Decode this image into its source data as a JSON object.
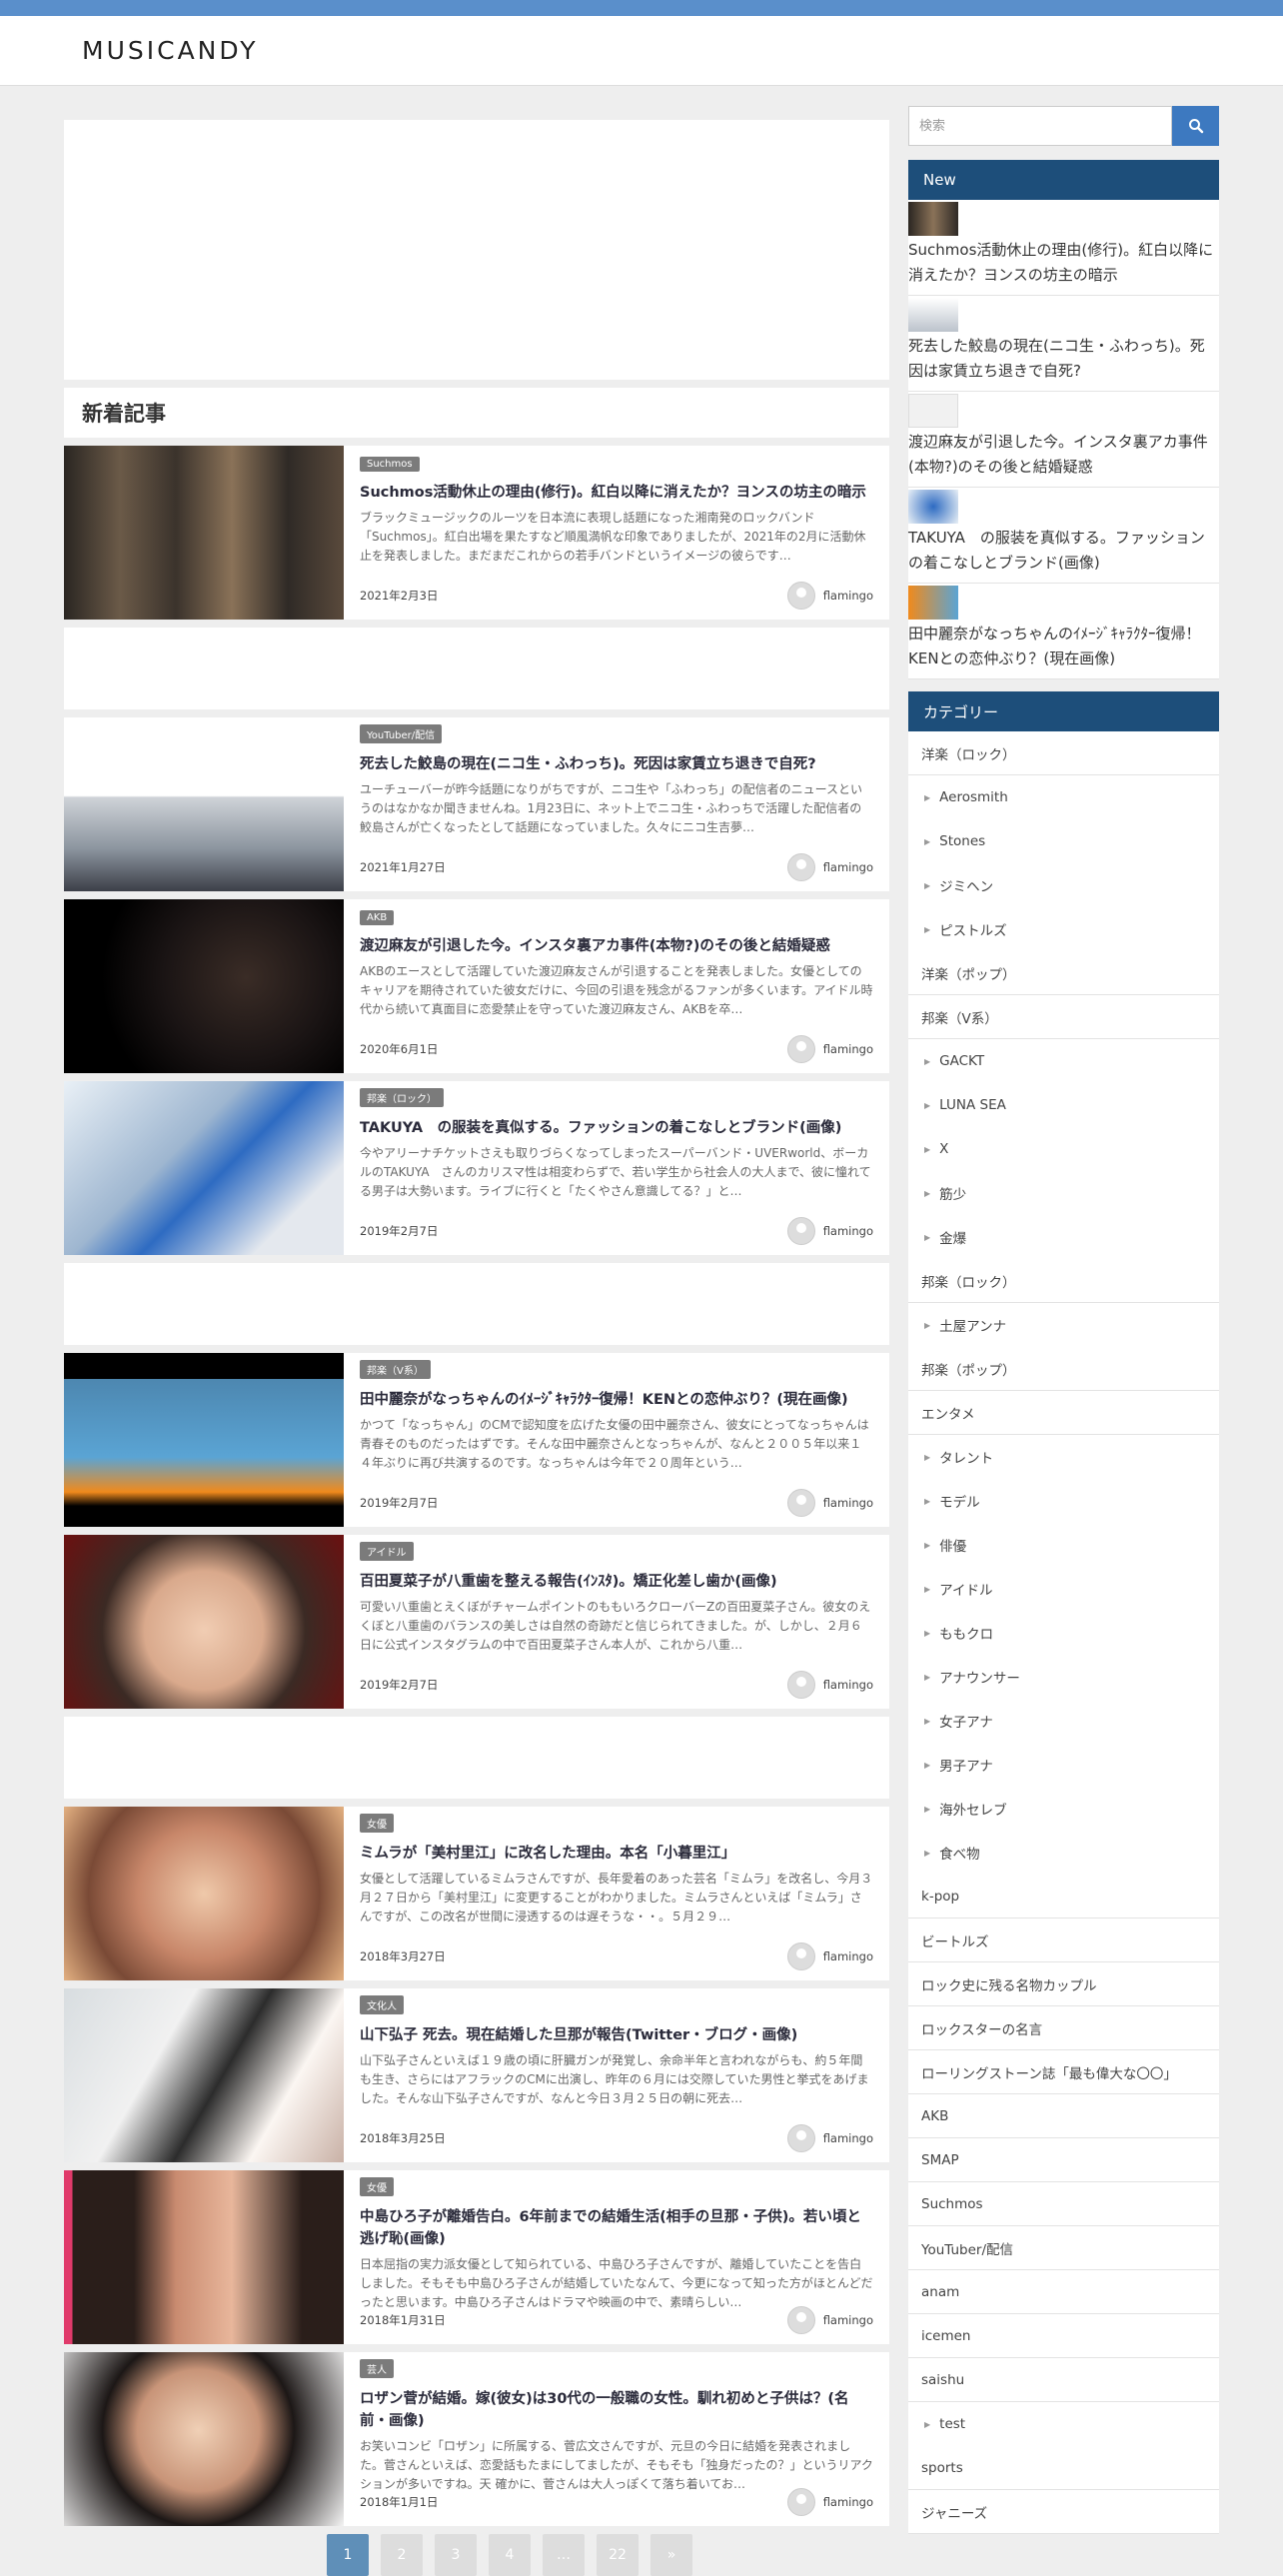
{
  "site": {
    "logo": "MUSICANDY"
  },
  "main": {
    "section_title": "新着記事",
    "articles": [
      {
        "tag": "Suchmos",
        "title": "Suchmos活動休止の理由(修行)。紅白以降に消えたか？ヨンスの坊主の暗示",
        "excerpt": "ブラックミュージックのルーツを日本流に表現し話題になった湘南発のロックバンド「Suchmos」。紅白出場を果たすなど順風満帆な印象でありましたが、2021年の2月に活動休止を発表しました。まだまだこれからの若手バンドというイメージの彼らです…",
        "date": "2021年2月3日",
        "author": "flamingo"
      },
      {
        "tag": "YouTuber/配信",
        "title": "死去した鮫島の現在(ニコ生・ふわっち)。死因は家賃立ち退きで自死?",
        "excerpt": "ユーチューバーが昨今話題になりがちですが、ニコ生や「ふわっち」の配信者のニュースというのはなかなか聞きませんね。1月23日に、ネット上でニコ生・ふわっちで活躍した配信者の鮫島さんが亡くなったとして話題になっていました。久々にニコ生吉夢…",
        "date": "2021年1月27日",
        "author": "flamingo"
      },
      {
        "tag": "AKB",
        "title": "渡辺麻友が引退した今。インスタ裏アカ事件(本物?)のその後と結婚疑惑",
        "excerpt": "AKBのエースとして活躍していた渡辺麻友さんが引退することを発表しました。女優としてのキャリアを期待されていた彼女だけに、今回の引退を残念がるファンが多くいます。アイドル時代から続いて真面目に恋愛禁止を守っていた渡辺麻友さん、AKBを卒…",
        "date": "2020年6月1日",
        "author": "flamingo"
      },
      {
        "tag": "邦楽（ロック）",
        "title": "TAKUYA　の服装を真似する。ファッションの着こなしとブランド(画像)",
        "excerpt": "今やアリーナチケットさえも取りづらくなってしまったスーパーバンド・UVERworld、ボーカルのTAKUYA　さんのカリスマ性は相変わらずで、若い学生から社会人の大人まで、彼に憧れてる男子は大勢います。ライブに行くと「たくやさん意識してる？」と…",
        "date": "2019年2月7日",
        "author": "flamingo"
      },
      {
        "tag": "邦楽（V系）",
        "title": "田中麗奈がなっちゃんのｲﾒｰｼﾞｷｬﾗｸﾀｰ復帰！KENとの恋仲ぶり？(現在画像)",
        "excerpt": "かつて「なっちゃん」のCMで認知度を広げた女優の田中麗奈さん、彼女にとってなっちゃんは青春そのものだったはずです。そんな田中麗奈さんとなっちゃんが、なんと２００５年以来１４年ぶりに再び共演するのです。なっちゃんは今年で２０周年という…",
        "date": "2019年2月7日",
        "author": "flamingo"
      },
      {
        "tag": "アイドル",
        "title": "百田夏菜子が八重歯を整える報告(ｲﾝｽﾀ)。矯正化差し歯か(画像)",
        "excerpt": "可愛い八重歯とえくぼがチャームポイントのももいろクローバーZの百田夏菜子さん。彼女のえくぼと八重歯のバランスの美しさは自然の奇跡だと信じられてきました。が、しかし、２月６日に公式インスタグラムの中で百田夏菜子さん本人が、これから八重…",
        "date": "2019年2月7日",
        "author": "flamingo"
      },
      {
        "tag": "女優",
        "title": "ミムラが「美村里江」に改名した理由。本名「小暮里江」",
        "excerpt": "女優として活躍しているミムラさんですが、長年愛着のあった芸名「ミムラ」を改名し、今月３月２７日から「美村里江」に変更することがわかりました。ミムラさんといえば「ミムラ」さんですが、この改名が世間に浸透するのは遅そうな・・。５月２９…",
        "date": "2018年3月27日",
        "author": "flamingo"
      },
      {
        "tag": "文化人",
        "title": "山下弘子 死去。現在結婚した旦那が報告(Twitter・ブログ・画像)",
        "excerpt": "山下弘子さんといえば１９歳の頃に肝臓ガンが発覚し、余命半年と言われながらも、約５年間も生き、さらにはアフラックのCMに出演し、昨年の６月には交際していた男性と挙式をあげました。そんな山下弘子さんですが、なんと今日３月２５日の朝に死去…",
        "date": "2018年3月25日",
        "author": "flamingo"
      },
      {
        "tag": "女優",
        "title": "中島ひろ子が離婚告白。6年前までの結婚生活(相手の旦那・子供)。若い頃と逃げ恥(画像)",
        "excerpt": "日本屈指の実力派女優として知られている、中島ひろ子さんですが、離婚していたことを告白しました。そもそも中島ひろ子さんが結婚していたなんて、今更になって知った方がほとんどだったと思います。中島ひろ子さんはドラマや映画の中で、素晴らしい…",
        "date": "2018年1月31日",
        "author": "flamingo"
      },
      {
        "tag": "芸人",
        "title": "ロザン菅が結婚。嫁(彼女)は30代の一般職の女性。馴れ初めと子供は？(名前・画像)",
        "excerpt": "お笑いコンビ「ロザン」に所属する、菅広文さんですが、元旦の今日に結婚を発表されました。菅さんといえば、恋愛話もたまにしてましたが、そもそも「独身だったの？」というリアクションが多いですね。天 確かに、菅さんは大人っぽくて落ち着いてお…",
        "date": "2018年1月1日",
        "author": "flamingo"
      }
    ],
    "pagination": [
      "1",
      "2",
      "3",
      "4",
      "…",
      "22",
      "»"
    ]
  },
  "sidebar": {
    "search_placeholder": "検索",
    "new_heading": "New",
    "new_items": [
      "Suchmos活動休止の理由(修行)。紅白以降に消えたか？ヨンスの坊主の暗示",
      "死去した鮫島の現在(ニコ生・ふわっち)。死因は家賃立ち退きで自死?",
      "渡辺麻友が引退した今。インスタ裏アカ事件(本物?)のその後と結婚疑惑",
      "TAKUYA　の服装を真似する。ファッションの着こなしとブランド(画像)",
      "田中麗奈がなっちゃんのｲﾒｰｼﾞｷｬﾗｸﾀｰ復帰！KENとの恋仲ぶり？(現在画像)"
    ],
    "category_heading": "カテゴリー",
    "categories": [
      {
        "label": "洋楽（ロック）",
        "child": false
      },
      {
        "label": "Aerosmith",
        "child": true
      },
      {
        "label": "Stones",
        "child": true
      },
      {
        "label": "ジミヘン",
        "child": true
      },
      {
        "label": "ピストルズ",
        "child": true
      },
      {
        "label": "洋楽（ポップ）",
        "child": false
      },
      {
        "label": "邦楽（V系）",
        "child": false
      },
      {
        "label": "GACKT",
        "child": true
      },
      {
        "label": "LUNA SEA",
        "child": true
      },
      {
        "label": "X",
        "child": true
      },
      {
        "label": "筋少",
        "child": true
      },
      {
        "label": "金爆",
        "child": true
      },
      {
        "label": "邦楽（ロック）",
        "child": false
      },
      {
        "label": "土屋アンナ",
        "child": true
      },
      {
        "label": "邦楽（ポップ）",
        "child": false
      },
      {
        "label": "エンタメ",
        "child": false
      },
      {
        "label": "タレント",
        "child": true
      },
      {
        "label": "モデル",
        "child": true
      },
      {
        "label": "俳優",
        "child": true
      },
      {
        "label": "アイドル",
        "child": true
      },
      {
        "label": "ももクロ",
        "child": true
      },
      {
        "label": "アナウンサー",
        "child": true
      },
      {
        "label": "女子アナ",
        "child": true
      },
      {
        "label": "男子アナ",
        "child": true
      },
      {
        "label": "海外セレブ",
        "child": true
      },
      {
        "label": "食べ物",
        "child": true
      },
      {
        "label": "k-pop",
        "child": false
      },
      {
        "label": "ビートルズ",
        "child": false
      },
      {
        "label": "ロック史に残る名物カップル",
        "child": false
      },
      {
        "label": "ロックスターの名言",
        "child": false
      },
      {
        "label": "ローリングストーン誌「最も偉大な〇〇」",
        "child": false
      },
      {
        "label": "AKB",
        "child": false
      },
      {
        "label": "SMAP",
        "child": false
      },
      {
        "label": "Suchmos",
        "child": false
      },
      {
        "label": "YouTuber/配信",
        "child": false
      },
      {
        "label": "anam",
        "child": false
      },
      {
        "label": "icemen",
        "child": false
      },
      {
        "label": "saishu",
        "child": false
      },
      {
        "label": "test",
        "child": true
      },
      {
        "label": "sports",
        "child": false
      },
      {
        "label": "ジャニーズ",
        "child": false
      }
    ]
  }
}
